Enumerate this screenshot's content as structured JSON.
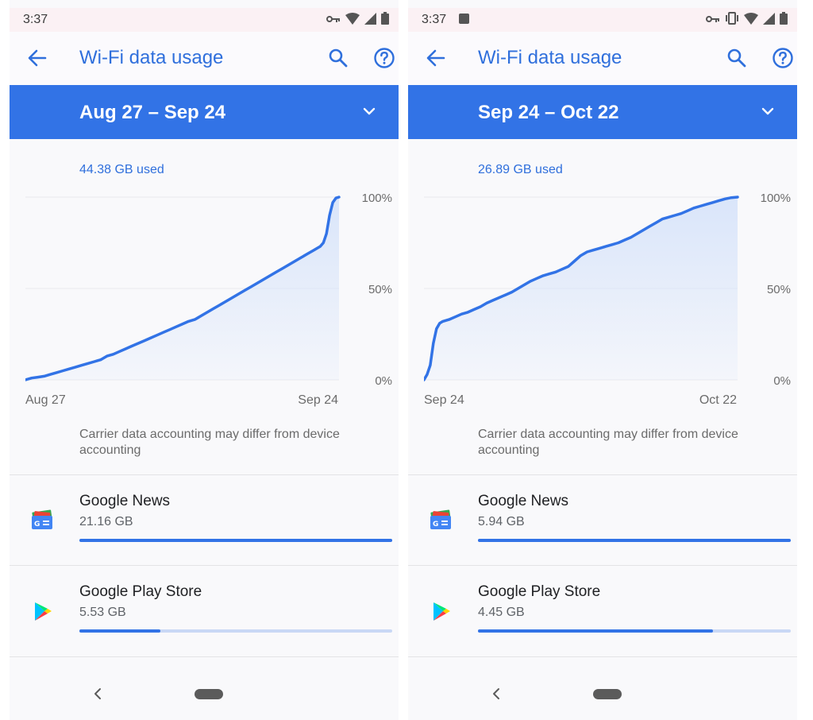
{
  "left": {
    "status": {
      "time": "3:37",
      "show_image_icon": false,
      "show_vibrate": false
    },
    "title": "Wi-Fi data usage",
    "cycle": "Aug 27 – Sep 24",
    "usage_used": "44.38 GB used",
    "chart_data": {
      "type": "area",
      "x_start_label": "Aug 27",
      "x_end_label": "Sep 24",
      "y_tick_labels": [
        "100%",
        "50%",
        "0%"
      ],
      "ylim": [
        0,
        100
      ],
      "x": [
        0,
        2,
        4,
        6,
        8,
        10,
        12,
        14,
        16,
        18,
        20,
        22,
        23,
        24,
        25,
        26,
        28,
        30,
        32,
        34,
        36,
        38,
        40,
        42,
        44,
        46,
        48,
        50,
        52,
        54,
        55,
        56,
        58,
        60,
        62,
        64,
        66,
        68,
        70,
        72,
        74,
        76,
        78,
        80,
        82,
        84,
        86,
        88,
        90,
        92,
        93,
        94,
        95,
        96,
        97,
        98,
        99,
        100
      ],
      "y": [
        0,
        1,
        1.5,
        2,
        3,
        4,
        5,
        6,
        7,
        8,
        9,
        10,
        10.5,
        11,
        12,
        13,
        14,
        15.5,
        17,
        18.5,
        20,
        21.5,
        23,
        24.5,
        26,
        27.5,
        29,
        30.5,
        32,
        33,
        34,
        35,
        37,
        39,
        41,
        43,
        45,
        47,
        49,
        51,
        53,
        55,
        57,
        59,
        61,
        63,
        65,
        67,
        69,
        71,
        72,
        73,
        75,
        80,
        90,
        97,
        99.5,
        100
      ]
    },
    "disclaimer": "Carrier data accounting may differ from device accounting",
    "apps": [
      {
        "name": "Google News",
        "usage": "21.16 GB",
        "fraction": 1.0,
        "icon": "google-news-icon"
      },
      {
        "name": "Google Play Store",
        "usage": "5.53 GB",
        "fraction": 0.26,
        "icon": "google-play-store-icon"
      }
    ]
  },
  "right": {
    "status": {
      "time": "3:37",
      "show_image_icon": true,
      "show_vibrate": true
    },
    "title": "Wi-Fi data usage",
    "cycle": "Sep 24 – Oct 22",
    "usage_used": "26.89 GB used",
    "chart_data": {
      "type": "area",
      "x_start_label": "Sep 24",
      "x_end_label": "Oct 22",
      "y_tick_labels": [
        "100%",
        "50%",
        "0%"
      ],
      "ylim": [
        0,
        100
      ],
      "x": [
        0,
        1,
        2,
        3,
        4,
        5,
        6,
        8,
        10,
        12,
        14,
        16,
        18,
        20,
        22,
        24,
        26,
        28,
        30,
        32,
        34,
        36,
        38,
        40,
        42,
        44,
        46,
        48,
        50,
        52,
        54,
        56,
        58,
        60,
        62,
        64,
        66,
        68,
        70,
        72,
        74,
        76,
        78,
        80,
        82,
        84,
        86,
        88,
        90,
        92,
        94,
        96,
        98,
        100
      ],
      "y": [
        0,
        3,
        8,
        20,
        28,
        31,
        32,
        33,
        34.5,
        36,
        37,
        38.5,
        40,
        42,
        43.5,
        45,
        46.5,
        48,
        50,
        52,
        54,
        55.5,
        57,
        58,
        59,
        60.5,
        62,
        65,
        68,
        70,
        71,
        72,
        73,
        74,
        75,
        76.5,
        78,
        80,
        82,
        84,
        86,
        88,
        89,
        90,
        91,
        92.5,
        94,
        95,
        96,
        97,
        98,
        99,
        99.7,
        100
      ]
    },
    "disclaimer": "Carrier data accounting may differ from device accounting",
    "apps": [
      {
        "name": "Google News",
        "usage": "5.94 GB",
        "fraction": 1.0,
        "icon": "google-news-icon"
      },
      {
        "name": "Google Play Store",
        "usage": "4.45 GB",
        "fraction": 0.75,
        "icon": "google-play-store-icon"
      }
    ]
  },
  "colors": {
    "accent": "#3273e6",
    "title": "#2f6fdc",
    "track": "#c9d8f5",
    "fill_top": "#d6e3fa",
    "grid": "#e9e9ee"
  }
}
